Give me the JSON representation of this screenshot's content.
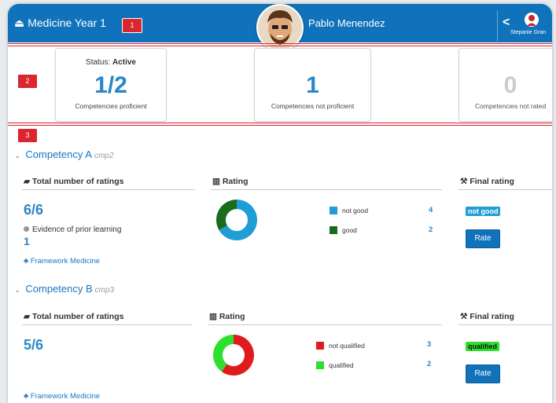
{
  "header": {
    "course_title": "Medicine Year 1",
    "badge_1": "1",
    "user_name": "Pablo Menendez",
    "switch_user_name": "Stepanie Gran"
  },
  "stats": {
    "badge": "2",
    "status_prefix": "Status:",
    "status_value": "Active",
    "cards": [
      {
        "value": "1/2",
        "label": "Competencies proficient"
      },
      {
        "value": "1",
        "label": "Competencies not proficient"
      },
      {
        "value": "0",
        "label": "Competencies not rated"
      }
    ]
  },
  "section_badge": "3",
  "competencies": [
    {
      "name": "Competency A",
      "code": "cmp2",
      "total_title": "Total number of ratings",
      "total": "6/6",
      "evidence_label": "Evidence of prior learning",
      "evidence_count": "1",
      "framework": "Framework Medicine",
      "rating_title": "Rating",
      "legend": [
        {
          "label": "not good",
          "value": "4",
          "color": "#1f9ed6"
        },
        {
          "label": "good",
          "value": "2",
          "color": "#1a6b1c"
        }
      ],
      "final_title": "Final rating",
      "final_value": "not good",
      "final_color": "#1f9ed6",
      "rate_label": "Rate"
    },
    {
      "name": "Competency B",
      "code": "cmp3",
      "total_title": "Total number of ratings",
      "total": "5/6",
      "framework": "Framework Medicine",
      "rating_title": "Rating",
      "legend": [
        {
          "label": "not qualified",
          "value": "3",
          "color": "#e01b1b"
        },
        {
          "label": "qualified",
          "value": "2",
          "color": "#2ee02e"
        }
      ],
      "final_title": "Final rating",
      "final_value": "qualified",
      "final_color": "#2ee02e",
      "rate_label": "Rate"
    }
  ]
}
